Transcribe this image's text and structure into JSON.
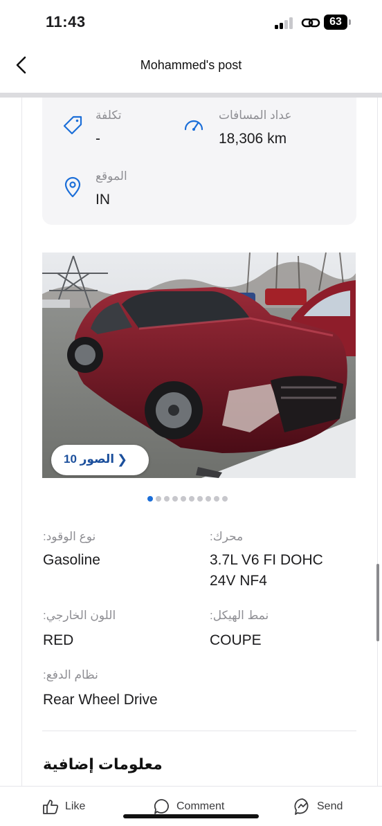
{
  "status_bar": {
    "time": "11:43",
    "battery": "63"
  },
  "header": {
    "title": "Mohammed's post"
  },
  "info": {
    "cost_label": "تكلفة",
    "cost_value": "-",
    "mileage_label": "عداد المسافات",
    "mileage_value": "18,306 km",
    "location_label": "الموقع",
    "location_value": "IN"
  },
  "gallery": {
    "photos_label": "الصور 10",
    "dots_total": 10,
    "dot_active": 0
  },
  "specs": {
    "fuel_label": ":نوع الوقود",
    "fuel_value": "Gasoline",
    "engine_label": ":محرك",
    "engine_value_line1": "3.7L V6 FI DOHC",
    "engine_value_line2": "24V NF4",
    "color_label": ":اللون الخارجي",
    "color_value": "RED",
    "body_label": ":نمط الهيكل",
    "body_value": "COUPE",
    "drive_label": ":نظام الدفع",
    "drive_value": "Rear Wheel Drive"
  },
  "section": {
    "title": "معلومات إضافية"
  },
  "actions": {
    "like": "Like",
    "comment": "Comment",
    "send": "Send"
  },
  "colors": {
    "accent_blue": "#1b4f9c",
    "dot_active": "#1b6ed8",
    "car_red": "#7a1422"
  },
  "icons": [
    "back-chevron-icon",
    "tag-icon",
    "speedometer-icon",
    "location-pin-icon",
    "like-icon",
    "comment-icon",
    "send-icon"
  ]
}
